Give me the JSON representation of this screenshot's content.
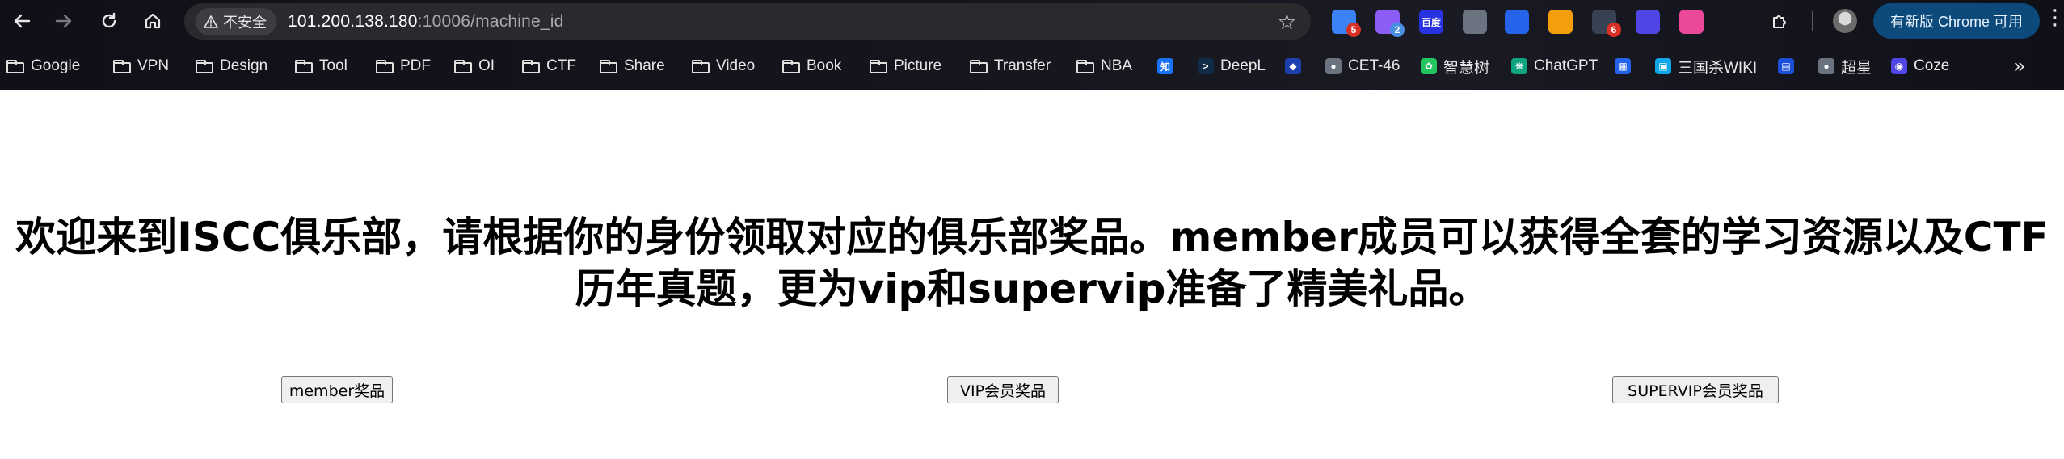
{
  "browser": {
    "site_info_label": "不安全",
    "url_host": "101.200.138.180",
    "url_path": ":10006/machine_id",
    "update_button_label": "有新版 Chrome 可用",
    "extensions": [
      {
        "name": "ext-1",
        "badge": "5",
        "color": "#3b82f6",
        "badge_color": "#d93025"
      },
      {
        "name": "ext-2",
        "badge": "2",
        "color": "#8b5cf6",
        "badge_color": "#4a90e2"
      },
      {
        "name": "baidu",
        "label": "百度",
        "color": "#2932e1"
      },
      {
        "name": "ext-4",
        "color": "#6b7280"
      },
      {
        "name": "ext-5",
        "color": "#2563eb"
      },
      {
        "name": "ext-6",
        "color": "#f59e0b"
      },
      {
        "name": "ext-7",
        "badge": "6",
        "color": "#374151",
        "badge_color": "#d93025"
      },
      {
        "name": "ext-8",
        "color": "#4f46e5"
      },
      {
        "name": "ext-9",
        "color": "#ec4899"
      }
    ]
  },
  "bookmarks": [
    {
      "label": "Google",
      "type": "folder"
    },
    {
      "label": "VPN",
      "type": "folder"
    },
    {
      "label": "Design",
      "type": "folder"
    },
    {
      "label": "Tool",
      "type": "folder"
    },
    {
      "label": "PDF",
      "type": "folder"
    },
    {
      "label": "OI",
      "type": "folder"
    },
    {
      "label": "CTF",
      "type": "folder"
    },
    {
      "label": "Share",
      "type": "folder"
    },
    {
      "label": "Video",
      "type": "folder"
    },
    {
      "label": "Book",
      "type": "folder"
    },
    {
      "label": "Picture",
      "type": "folder"
    },
    {
      "label": "Transfer",
      "type": "folder"
    },
    {
      "label": "NBA",
      "type": "folder"
    },
    {
      "label": "",
      "type": "site",
      "icon": "知",
      "color": "#1772f6"
    },
    {
      "label": "DeepL",
      "type": "site",
      "icon": ">",
      "color": "#0f2b46"
    },
    {
      "label": "",
      "type": "site",
      "icon": "◆",
      "color": "#1e40af"
    },
    {
      "label": "CET-46",
      "type": "site",
      "icon": "●",
      "color": "#6b7280"
    },
    {
      "label": "智慧树",
      "type": "site",
      "icon": "✿",
      "color": "#22c55e"
    },
    {
      "label": "ChatGPT",
      "type": "site",
      "icon": "❋",
      "color": "#10a37f"
    },
    {
      "label": "",
      "type": "site",
      "icon": "▦",
      "color": "#2563eb"
    },
    {
      "label": "三国杀WIKI",
      "type": "site",
      "icon": "▣",
      "color": "#0ea5e9"
    },
    {
      "label": "",
      "type": "site",
      "icon": "▤",
      "color": "#1d4ed8"
    },
    {
      "label": "超星",
      "type": "site",
      "icon": "●",
      "color": "#6b7280"
    },
    {
      "label": "Coze",
      "type": "site",
      "icon": "◉",
      "color": "#4f46e5"
    }
  ],
  "page": {
    "heading": "欢迎来到ISCC俱乐部，请根据你的身份领取对应的俱乐部奖品。member成员可以获得全套的学习资源以及CTF历年真题，更为vip和supervip准备了精美礼品。",
    "buttons": {
      "member": "member奖品",
      "vip": "VIP会员奖品",
      "supervip": "SUPERVIP会员奖品"
    }
  }
}
